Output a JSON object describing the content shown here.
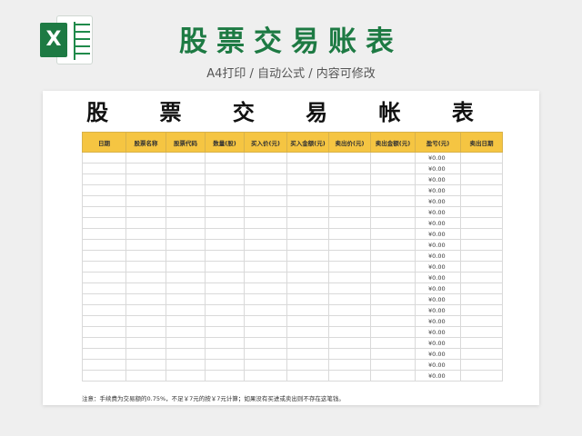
{
  "banner": {
    "logo_letter": "X",
    "title": "股票交易账表",
    "subtitle": "A4打印 / 自动公式 / 内容可修改"
  },
  "sheet": {
    "title": "股 票 交 易 帐 表",
    "columns": [
      "日期",
      "股票名称",
      "股票代码",
      "数量(股)",
      "买入价(元)",
      "买入金额(元)",
      "卖出价(元)",
      "卖出金额(元)",
      "盈亏(元)",
      "卖出日期"
    ],
    "rows": [
      "¥0.00",
      "¥0.00",
      "¥0.00",
      "¥0.00",
      "¥0.00",
      "¥0.00",
      "¥0.00",
      "¥0.00",
      "¥0.00",
      "¥0.00",
      "¥0.00",
      "¥0.00",
      "¥0.00",
      "¥0.00",
      "¥0.00",
      "¥0.00",
      "¥0.00",
      "¥0.00",
      "¥0.00",
      "¥0.00",
      "¥0.00"
    ],
    "note": "注意：手续费为交易额的0.75%，不足￥7元的按￥7元计算；如果没有买进或卖出则不存在这笔钱。"
  },
  "colors": {
    "brand_green": "#1d7a43",
    "header_yellow": "#f5c542"
  }
}
